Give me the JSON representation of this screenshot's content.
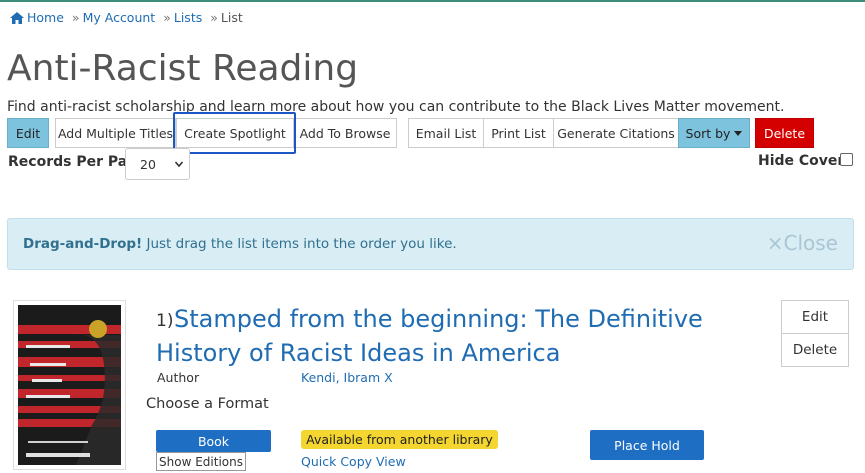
{
  "breadcrumb": {
    "home": "Home",
    "my_account": "My Account",
    "lists": "Lists",
    "current": "List"
  },
  "list": {
    "title": "Anti-Racist Reading",
    "description": "Find anti-racist scholarship and learn more about how you can contribute to the Black Lives Matter movement."
  },
  "toolbar": {
    "edit": "Edit",
    "add_multiple": "Add Multiple Titles",
    "create_spotlight": "Create Spotlight",
    "add_to_browse": "Add To Browse",
    "email_list": "Email List",
    "print_list": "Print List",
    "generate_citations": "Generate Citations",
    "sort_by": "Sort by",
    "delete": "Delete"
  },
  "records_per_page": {
    "label": "Records Per Page",
    "value": "20"
  },
  "hide_covers": {
    "label": "Hide Covers",
    "checked": false
  },
  "alert": {
    "bold": "Drag-and-Drop!",
    "text": " Just drag the list items into the order you like.",
    "close": "×Close"
  },
  "item": {
    "number": "1)",
    "title": "Stamped from the beginning: The Definitive History of Racist Ideas in America",
    "author_label": "Author",
    "author": "Kendi, Ibram X",
    "choose_format": "Choose a Format",
    "format_button": "Book",
    "show_editions": "Show Editions",
    "availability": "Available from another library",
    "quick_copy": "Quick Copy View",
    "place_hold": "Place Hold",
    "edit": "Edit",
    "delete": "Delete"
  },
  "colors": {
    "accent_blue": "#7ec3de",
    "link": "#1f6cb3",
    "danger": "#d40000",
    "primary": "#1e6fc4",
    "available": "#f5d631",
    "alert_bg": "#d9edf4"
  }
}
